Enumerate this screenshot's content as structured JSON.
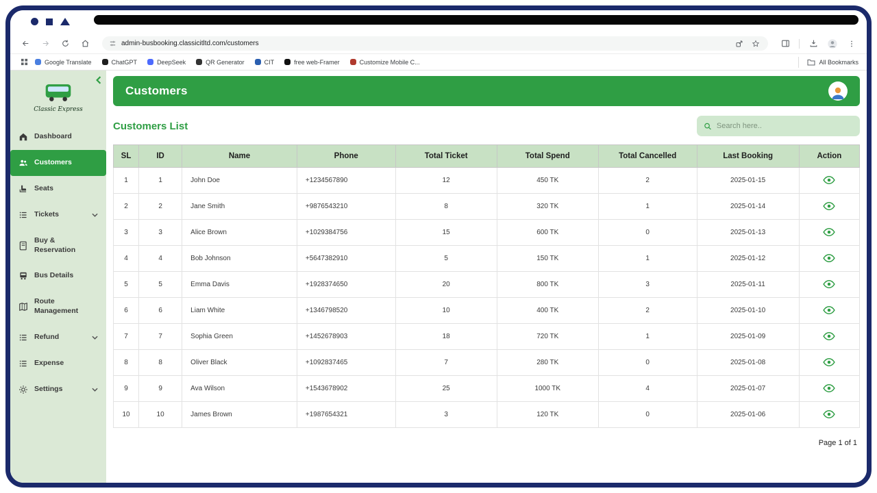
{
  "theme": {
    "primary_green": "#2f9e44",
    "sidebar_bg": "#dbe9d6",
    "table_header_bg": "#c8e1c4",
    "frame_navy": "#1b2a6b"
  },
  "browser": {
    "url": "admin-busbooking.classicitltd.com/customers",
    "bookmarks": [
      {
        "label": "Google Translate",
        "color": "#4a7fe0"
      },
      {
        "label": "ChatGPT",
        "color": "#1f1f1f"
      },
      {
        "label": "DeepSeek",
        "color": "#4d6bfe"
      },
      {
        "label": "QR Generator",
        "color": "#333333"
      },
      {
        "label": "CIT",
        "color": "#2b5fb0"
      },
      {
        "label": "free web-Framer",
        "color": "#111111"
      },
      {
        "label": "Customize Mobile C...",
        "color": "#b03a2e"
      }
    ],
    "all_bookmarks_label": "All Bookmarks"
  },
  "sidebar": {
    "brand": "Classic Express",
    "items": [
      {
        "label": "Dashboard",
        "active": false,
        "expandable": false
      },
      {
        "label": "Customers",
        "active": true,
        "expandable": false
      },
      {
        "label": "Seats",
        "active": false,
        "expandable": false
      },
      {
        "label": "Tickets",
        "active": false,
        "expandable": true
      },
      {
        "label": "Buy & Reservation",
        "active": false,
        "expandable": false
      },
      {
        "label": "Bus Details",
        "active": false,
        "expandable": false
      },
      {
        "label": "Route Management",
        "active": false,
        "expandable": false
      },
      {
        "label": "Refund",
        "active": false,
        "expandable": true
      },
      {
        "label": "Expense",
        "active": false,
        "expandable": false
      },
      {
        "label": "Settings",
        "active": false,
        "expandable": true
      }
    ]
  },
  "header": {
    "title": "Customers"
  },
  "main": {
    "list_title": "Customers List",
    "search_placeholder": "Search here..",
    "pagination": "Page 1 of 1"
  },
  "table": {
    "columns": [
      "SL",
      "ID",
      "Name",
      "Phone",
      "Total Ticket",
      "Total Spend",
      "Total Cancelled",
      "Last Booking",
      "Action"
    ],
    "rows": [
      {
        "sl": "1",
        "id": "1",
        "name": "John Doe",
        "phone": "+1234567890",
        "total_ticket": "12",
        "total_spend": "450 TK",
        "total_cancelled": "2",
        "last_booking": "2025-01-15"
      },
      {
        "sl": "2",
        "id": "2",
        "name": "Jane Smith",
        "phone": "+9876543210",
        "total_ticket": "8",
        "total_spend": "320 TK",
        "total_cancelled": "1",
        "last_booking": "2025-01-14"
      },
      {
        "sl": "3",
        "id": "3",
        "name": "Alice Brown",
        "phone": "+1029384756",
        "total_ticket": "15",
        "total_spend": "600 TK",
        "total_cancelled": "0",
        "last_booking": "2025-01-13"
      },
      {
        "sl": "4",
        "id": "4",
        "name": "Bob Johnson",
        "phone": "+5647382910",
        "total_ticket": "5",
        "total_spend": "150 TK",
        "total_cancelled": "1",
        "last_booking": "2025-01-12"
      },
      {
        "sl": "5",
        "id": "5",
        "name": "Emma Davis",
        "phone": "+1928374650",
        "total_ticket": "20",
        "total_spend": "800 TK",
        "total_cancelled": "3",
        "last_booking": "2025-01-11"
      },
      {
        "sl": "6",
        "id": "6",
        "name": "Liam White",
        "phone": "+1346798520",
        "total_ticket": "10",
        "total_spend": "400 TK",
        "total_cancelled": "2",
        "last_booking": "2025-01-10"
      },
      {
        "sl": "7",
        "id": "7",
        "name": "Sophia Green",
        "phone": "+1452678903",
        "total_ticket": "18",
        "total_spend": "720 TK",
        "total_cancelled": "1",
        "last_booking": "2025-01-09"
      },
      {
        "sl": "8",
        "id": "8",
        "name": "Oliver Black",
        "phone": "+1092837465",
        "total_ticket": "7",
        "total_spend": "280 TK",
        "total_cancelled": "0",
        "last_booking": "2025-01-08"
      },
      {
        "sl": "9",
        "id": "9",
        "name": "Ava Wilson",
        "phone": "+1543678902",
        "total_ticket": "25",
        "total_spend": "1000 TK",
        "total_cancelled": "4",
        "last_booking": "2025-01-07"
      },
      {
        "sl": "10",
        "id": "10",
        "name": "James Brown",
        "phone": "+1987654321",
        "total_ticket": "3",
        "total_spend": "120 TK",
        "total_cancelled": "0",
        "last_booking": "2025-01-06"
      }
    ]
  }
}
